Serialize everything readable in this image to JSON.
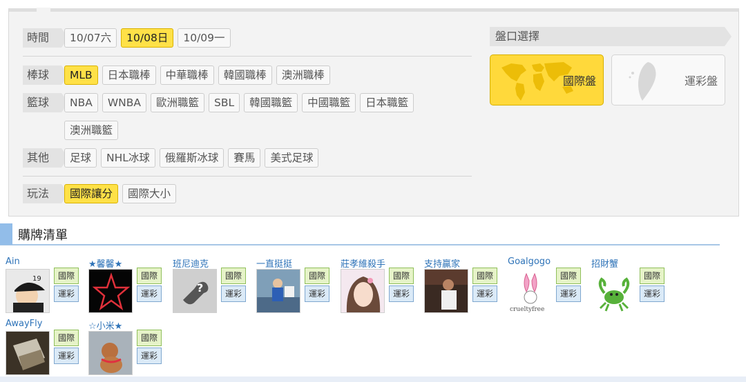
{
  "filters": {
    "time": {
      "label": "時間",
      "options": [
        {
          "text": "10/07六",
          "selected": false
        },
        {
          "text": "10/08日",
          "selected": true
        },
        {
          "text": "10/09一",
          "selected": false
        }
      ]
    },
    "baseball": {
      "label": "棒球",
      "options": [
        {
          "text": "MLB",
          "selected": true
        },
        {
          "text": "日本職棒",
          "selected": false
        },
        {
          "text": "中華職棒",
          "selected": false
        },
        {
          "text": "韓國職棒",
          "selected": false
        },
        {
          "text": "澳洲職棒",
          "selected": false
        }
      ]
    },
    "basketball": {
      "label": "籃球",
      "options": [
        {
          "text": "NBA"
        },
        {
          "text": "WNBA"
        },
        {
          "text": "歐洲職籃"
        },
        {
          "text": "SBL"
        },
        {
          "text": "韓國職籃"
        },
        {
          "text": "中國職籃"
        },
        {
          "text": "日本職籃"
        },
        {
          "text": "澳洲職籃"
        }
      ]
    },
    "other": {
      "label": "其他",
      "options": [
        {
          "text": "足球"
        },
        {
          "text": "NHL冰球"
        },
        {
          "text": "俄羅斯冰球"
        },
        {
          "text": "賽馬"
        },
        {
          "text": "美式足球"
        }
      ]
    },
    "play": {
      "label": "玩法",
      "options": [
        {
          "text": "國際讓分",
          "selected": true
        },
        {
          "text": "國際大小",
          "selected": false
        }
      ]
    }
  },
  "market": {
    "title": "盤口選擇",
    "international": "國際盤",
    "taiwan": "運彩盤"
  },
  "section_title": "購牌清單",
  "user_buttons": {
    "intl": "國際",
    "lottery": "運彩"
  },
  "users": [
    {
      "name": "Ain"
    },
    {
      "name": "★馨馨★"
    },
    {
      "name": "班尼迪克"
    },
    {
      "name": "一直挺挺"
    },
    {
      "name": "莊孝維殺手"
    },
    {
      "name": "支持贏家"
    },
    {
      "name": "Goalgogo"
    },
    {
      "name": "招財蟹"
    },
    {
      "name": "AwayFly"
    },
    {
      "name": "☆小米★"
    }
  ],
  "avatar_texts": {
    "yankees_number": "19",
    "cruelty": "crueltyfree"
  },
  "colors": {
    "selected": "#ffe147",
    "accent_blue": "#2e73b8",
    "intl_green": "#e6f3c8",
    "lottery_blue": "#dbeaf7"
  }
}
